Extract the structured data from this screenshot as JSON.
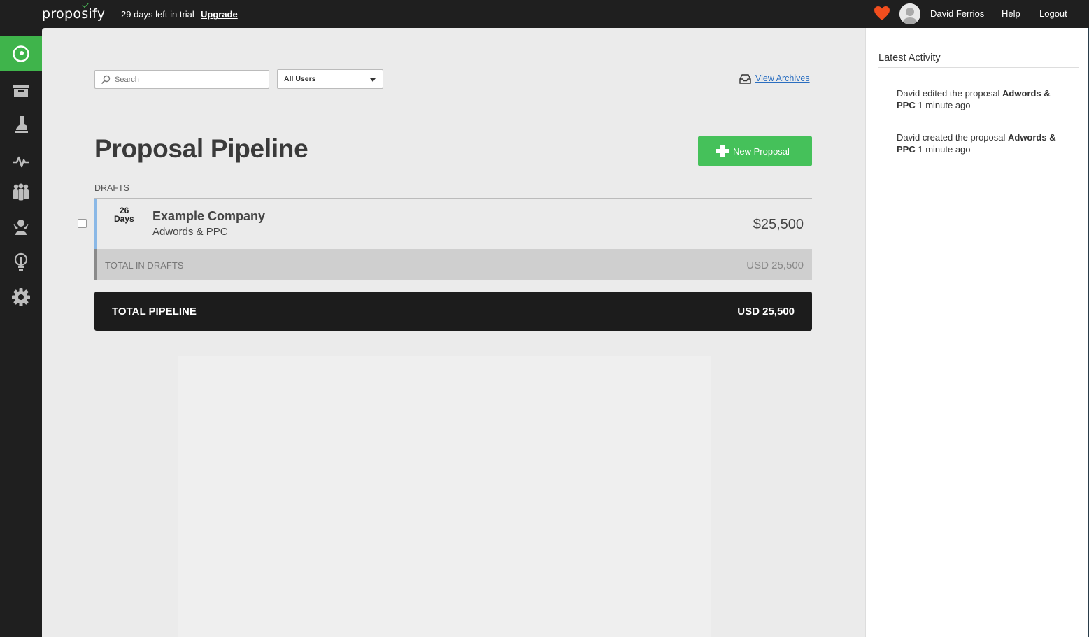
{
  "app": {
    "logo": "proposify",
    "trial_text": "29 days left in trial",
    "upgrade_label": "Upgrade"
  },
  "topbar": {
    "user_name": "David Ferrios",
    "help_label": "Help",
    "logout_label": "Logout"
  },
  "sidebar": {
    "items": [
      {
        "icon": "pipeline-icon",
        "active": true
      },
      {
        "icon": "archive-icon",
        "active": false
      },
      {
        "icon": "templates-icon",
        "active": false
      },
      {
        "icon": "metrics-icon",
        "active": false
      },
      {
        "icon": "clients-icon",
        "active": false
      },
      {
        "icon": "team-icon",
        "active": false
      },
      {
        "icon": "ideas-icon",
        "active": false
      },
      {
        "icon": "settings-icon",
        "active": false
      }
    ]
  },
  "toolbar": {
    "search_placeholder": "Search",
    "users_filter": "All Users",
    "view_archives": "View Archives"
  },
  "main": {
    "title": "Proposal Pipeline",
    "new_proposal_label": "New Proposal",
    "section_label": "DRAFTS",
    "proposals": [
      {
        "days": "26",
        "days_label": "Days",
        "company": "Example Company",
        "name": "Adwords & PPC",
        "amount": "$25,500"
      }
    ],
    "total_drafts_label": "TOTAL IN DRAFTS",
    "total_drafts_value": "USD 25,500",
    "total_pipeline_label": "TOTAL PIPELINE",
    "total_pipeline_value": "USD 25,500"
  },
  "activity": {
    "title": "Latest Activity",
    "items": [
      {
        "prefix": "David edited the proposal ",
        "subject": "Adwords & PPC",
        "suffix": " 1 minute ago"
      },
      {
        "prefix": "David created the proposal ",
        "subject": "Adwords & PPC",
        "suffix": " 1 minute ago"
      }
    ]
  },
  "colors": {
    "accent_green": "#45c15a",
    "link_blue": "#2a6ec0",
    "heart_red": "#f24e1e",
    "dark_bar": "#1f1f1f"
  }
}
